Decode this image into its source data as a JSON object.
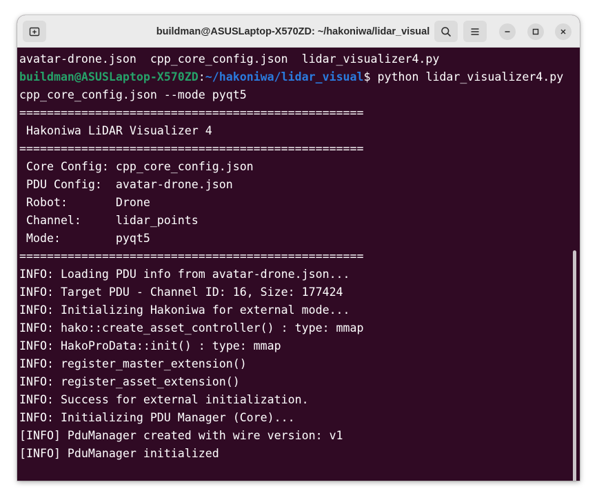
{
  "window": {
    "title": "buildman@ASUSLaptop-X570ZD: ~/hakoniwa/lidar_visual"
  },
  "icons": {
    "new_tab": "new-tab-icon",
    "search": "search-icon",
    "menu": "hamburger-menu-icon",
    "minimize": "minimize-icon",
    "maximize": "maximize-icon",
    "close": "close-icon"
  },
  "colors": {
    "terminal_bg": "#300a24",
    "prompt_user": "#26a269",
    "prompt_path": "#2a7bde"
  },
  "terminal": {
    "line0": "avatar-drone.json  cpp_core_config.json  lidar_visualizer4.py",
    "prompt": {
      "user_host": "buildman@ASUSLaptop-X570ZD",
      "colon": ":",
      "path": "~/hakoniwa/lidar_visual",
      "dollar": "$",
      "command": " python lidar_visualizer4.py"
    },
    "line2": "cpp_core_config.json --mode pyqt5",
    "line3": "==================================================",
    "line4": " Hakoniwa LiDAR Visualizer 4",
    "line5": "==================================================",
    "line6": " Core Config: cpp_core_config.json",
    "line7": " PDU Config:  avatar-drone.json",
    "line8": " Robot:       Drone",
    "line9": " Channel:     lidar_points",
    "line10": " Mode:        pyqt5",
    "line11": "==================================================",
    "line12": "INFO: Loading PDU info from avatar-drone.json...",
    "line13": "INFO: Target PDU - Channel ID: 16, Size: 177424",
    "line14": "INFO: Initializing Hakoniwa for external mode...",
    "line15": "INFO: hako::create_asset_controller() : type: mmap",
    "line16": "INFO: HakoProData::init() : type: mmap",
    "line17": "INFO: register_master_extension()",
    "line18": "INFO: register_asset_extension()",
    "line19": "INFO: Success for external initialization.",
    "line20": "INFO: Initializing PDU Manager (Core)...",
    "line21": "[INFO] PduManager created with wire version: v1",
    "line22": "[INFO] PduManager initialized"
  }
}
